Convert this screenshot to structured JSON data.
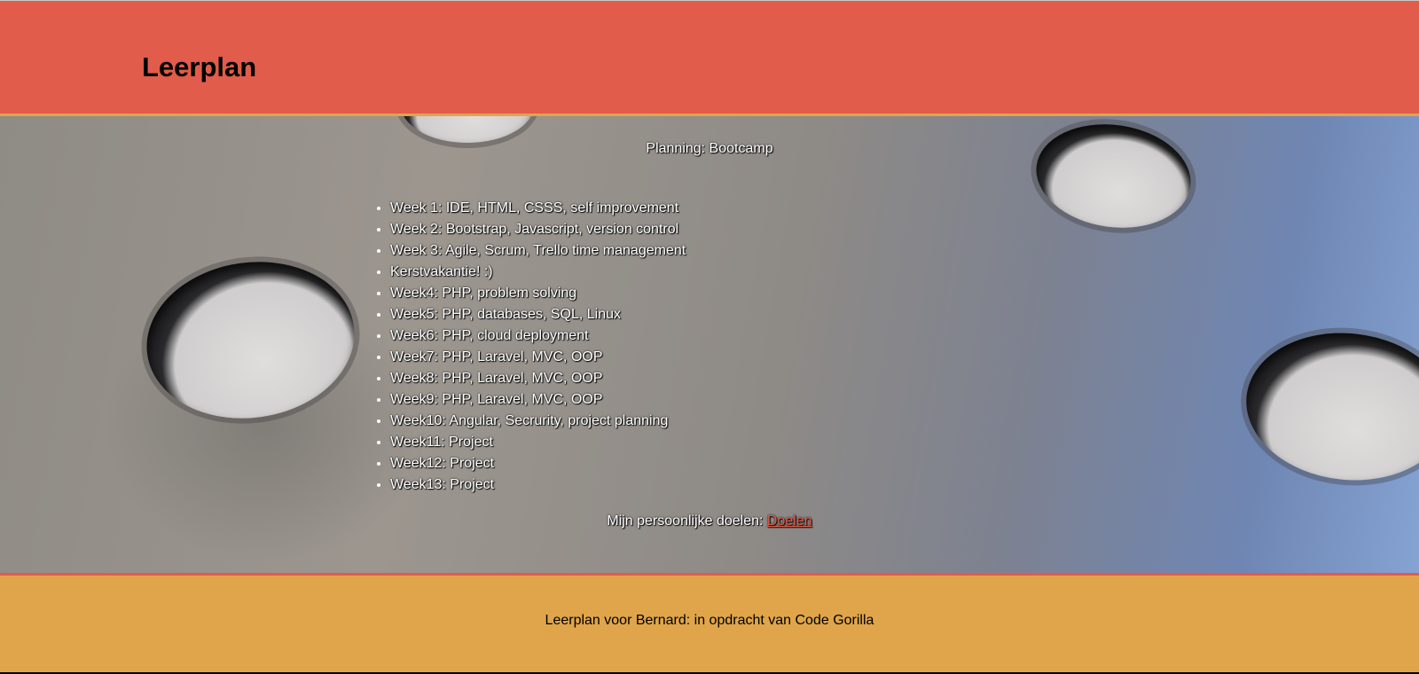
{
  "header": {
    "title": "Leerplan"
  },
  "main": {
    "planning_heading": "Planning: Bootcamp",
    "weeks": [
      "Week 1: IDE, HTML, CSSS, self improvement",
      "Week 2: Bootstrap, Javascript, version control",
      "Week 3: Agile, Scrum, Trello time management",
      "Kerstvakantie! :)",
      "Week4: PHP, problem solving",
      "Week5: PHP, databases, SQL, Linux",
      "Week6: PHP, cloud deployment",
      "Week7: PHP, Laravel, MVC, OOP",
      "Week8: PHP, Laravel, MVC, OOP",
      "Week9: PHP, Laravel, MVC, OOP",
      "Week10: Angular, Secrurity, project planning",
      "Week11: Project",
      "Week12: Project",
      "Week13: Project"
    ],
    "goals_text": "Mijn persoonlijke doelen:",
    "goals_link": "Doelen"
  },
  "footer": {
    "text": "Leerplan voor Bernard: in opdracht van Code Gorilla"
  },
  "colors": {
    "header_bg": "#e15c4a",
    "footer_bg": "#e0a54a",
    "link": "#e15c4a"
  }
}
